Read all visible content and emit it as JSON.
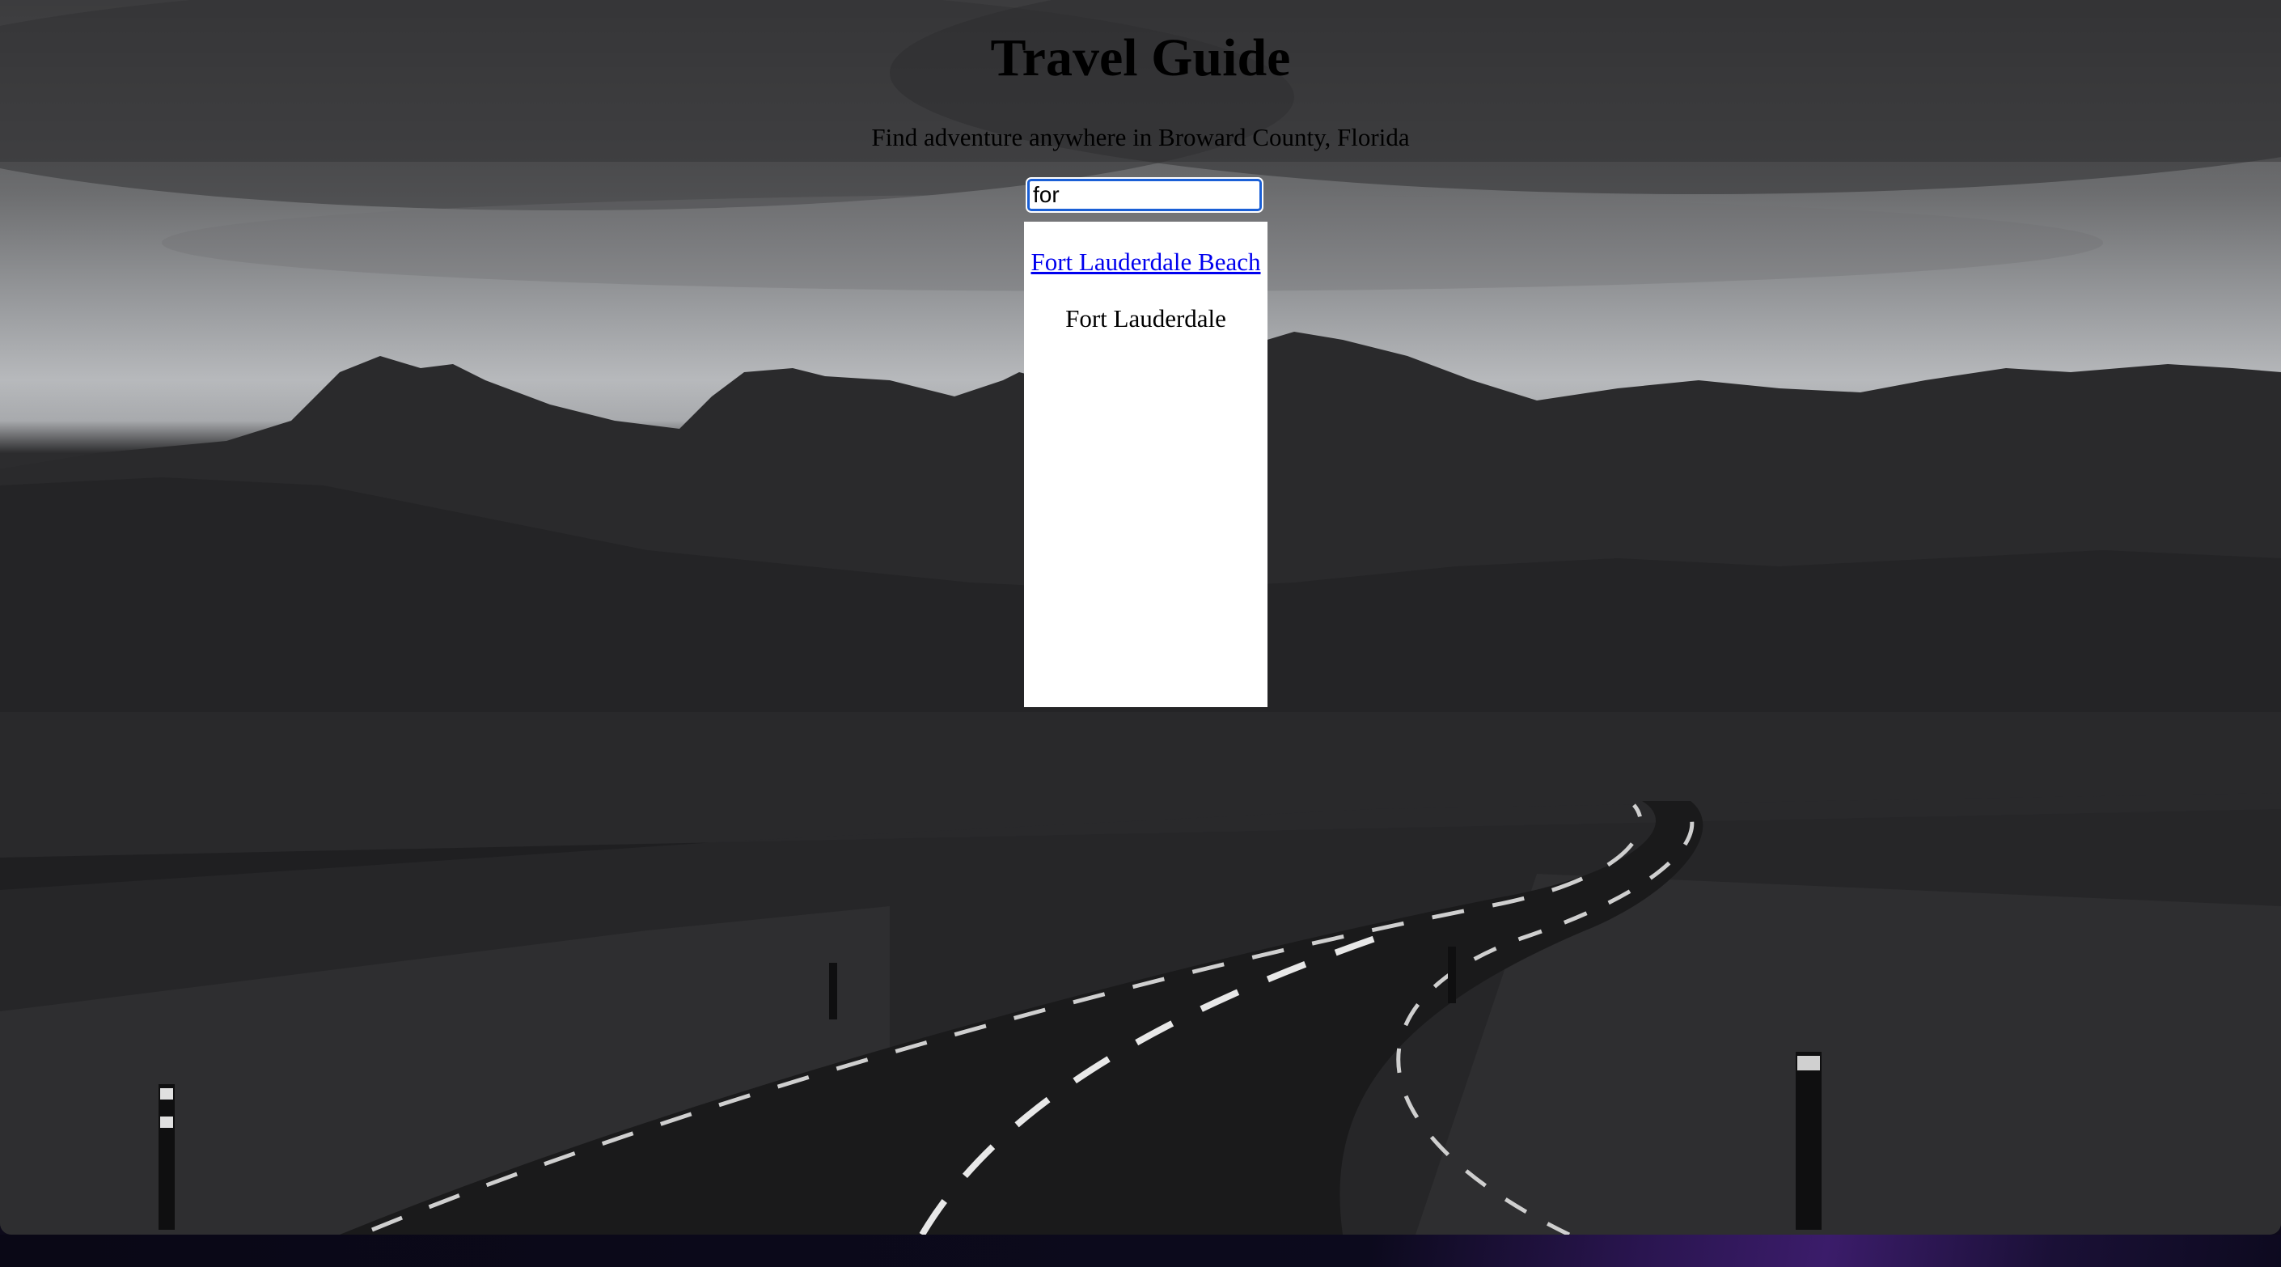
{
  "page": {
    "title": "Travel Guide",
    "subtitle": "Find adventure anywhere in Broward County, Florida"
  },
  "search": {
    "value": "for",
    "placeholder": ""
  },
  "results": [
    {
      "label": "Fort Lauderdale Beach",
      "link": true
    },
    {
      "label": "Fort Lauderdale",
      "link": false
    }
  ],
  "colors": {
    "link": "#0000ee",
    "focus_ring": "#1a5fd6",
    "results_bg": "#ffffff"
  },
  "background": {
    "icon": "mountain-road-photo"
  }
}
